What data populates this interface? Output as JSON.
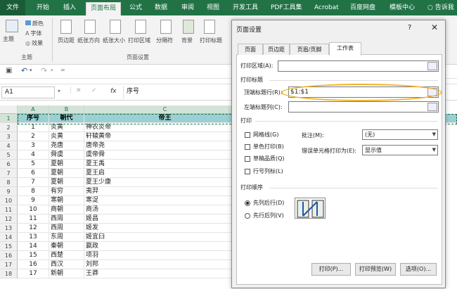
{
  "ribbon_tabs": [
    {
      "label": "文件",
      "active": false,
      "file": true
    },
    {
      "label": "开始",
      "active": false
    },
    {
      "label": "插入",
      "active": false
    },
    {
      "label": "页面布局",
      "active": true
    },
    {
      "label": "公式",
      "active": false
    },
    {
      "label": "数据",
      "active": false
    },
    {
      "label": "审阅",
      "active": false
    },
    {
      "label": "视图",
      "active": false
    },
    {
      "label": "开发工具",
      "active": false
    },
    {
      "label": "PDF工具集",
      "active": false
    },
    {
      "label": "Acrobat",
      "active": false
    },
    {
      "label": "百度网盘",
      "active": false
    },
    {
      "label": "模板中心",
      "active": false
    }
  ],
  "tell_me": "告诉我",
  "ribbon": {
    "theme_group": "主题",
    "theme_btn": "主题",
    "colors": "颜色",
    "fonts": "字体",
    "effects": "效果",
    "margins": "页边距",
    "orientation": "纸张方向",
    "size": "纸张大小",
    "print_area": "打印区域",
    "breaks": "分隔符",
    "background": "背景",
    "print_titles": "打印标题",
    "page_setup_group": "页面设置"
  },
  "formula_bar": {
    "name_box": "A1",
    "fx": "fx",
    "value": "序号"
  },
  "sheet": {
    "columns": [
      {
        "letter": "A",
        "selected": true
      },
      {
        "letter": "B",
        "selected": true
      },
      {
        "letter": "C",
        "selected": true
      }
    ],
    "headers": [
      "序号",
      "朝代",
      "帝王"
    ],
    "rows": [
      {
        "n": "2",
        "a": "1",
        "b": "炎黄",
        "c": "神农炎帝"
      },
      {
        "n": "3",
        "a": "2",
        "b": "炎黄",
        "c": "轩辕黄帝"
      },
      {
        "n": "4",
        "a": "3",
        "b": "尧唐",
        "c": "唐帝尧"
      },
      {
        "n": "5",
        "a": "4",
        "b": "舜虞",
        "c": "虞帝舜"
      },
      {
        "n": "6",
        "a": "5",
        "b": "夏朝",
        "c": "夏王禹"
      },
      {
        "n": "7",
        "a": "6",
        "b": "夏朝",
        "c": "夏王启"
      },
      {
        "n": "8",
        "a": "7",
        "b": "夏朝",
        "c": "夏王少康"
      },
      {
        "n": "9",
        "a": "8",
        "b": "有穷",
        "c": "夷羿"
      },
      {
        "n": "10",
        "a": "9",
        "b": "寒朝",
        "c": "寒浞"
      },
      {
        "n": "11",
        "a": "10",
        "b": "商朝",
        "c": "商汤"
      },
      {
        "n": "12",
        "a": "11",
        "b": "西周",
        "c": "姬昌"
      },
      {
        "n": "13",
        "a": "12",
        "b": "西周",
        "c": "姬发"
      },
      {
        "n": "14",
        "a": "13",
        "b": "东周",
        "c": "姬宜臼"
      },
      {
        "n": "15",
        "a": "14",
        "b": "秦朝",
        "c": "嬴政"
      },
      {
        "n": "16",
        "a": "15",
        "b": "西楚",
        "c": "项羽"
      },
      {
        "n": "17",
        "a": "16",
        "b": "西汉",
        "c": "刘邦"
      },
      {
        "n": "18",
        "a": "17",
        "b": "新朝",
        "c": "王莽"
      }
    ]
  },
  "dialog": {
    "title": "页面设置",
    "help": "?",
    "close": "✕",
    "tabs": [
      {
        "label": "页面",
        "active": false
      },
      {
        "label": "页边距",
        "active": false
      },
      {
        "label": "页眉/页脚",
        "active": false
      },
      {
        "label": "工作表",
        "active": true
      }
    ],
    "print_area_label": "打印区域(A):",
    "print_area_value": "",
    "print_titles_section": "打印标题",
    "title_rows_label": "顶端标题行(R):",
    "title_rows_value": "$1:$1",
    "title_cols_label": "左端标题列(C):",
    "title_cols_value": "",
    "print_section": "打印",
    "gridlines": "网格线(G)",
    "bw": "单色打印(B)",
    "draft": "草稿品质(Q)",
    "row_col_headings": "行号列标(L)",
    "comments_label": "批注(M):",
    "comments_value": "(无)",
    "errors_label": "错误单元格打印为(E):",
    "errors_value": "显示值",
    "order_section": "打印顺序",
    "down_then_over": "先列后行(D)",
    "over_then_down": "先行后列(V)",
    "down_then_over_selected": true,
    "print_btn": "打印(P)...",
    "preview_btn": "打印预览(W)",
    "options_btn": "选项(O)..."
  }
}
